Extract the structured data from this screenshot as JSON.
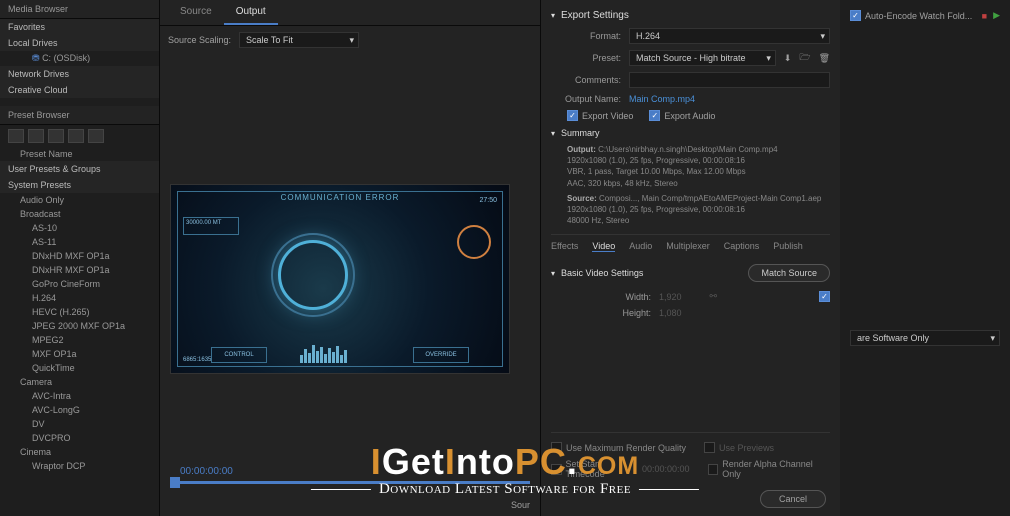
{
  "leftPanel": {
    "header1": "Media Browser",
    "favorites": "Favorites",
    "localDrives": "Local Drives",
    "cDrive": "C: (OSDisk)",
    "networkDrives": "Network Drives",
    "creativeCloud": "Creative Cloud",
    "header2": "Preset Browser",
    "presetName": "Preset Name",
    "userPresets": "User Presets & Groups",
    "systemPresets": "System Presets",
    "items": [
      "Audio Only",
      "Broadcast",
      "AS-10",
      "AS-11",
      "DNxHD MXF OP1a",
      "DNxHR MXF OP1a",
      "GoPro CineForm",
      "H.264",
      "HEVC (H.265)",
      "JPEG 2000 MXF OP1a",
      "MPEG2",
      "MXF OP1a",
      "QuickTime"
    ],
    "camera": "Camera",
    "camItems": [
      "AVC-Intra",
      "AVC-LongG",
      "DV",
      "DVCPRO"
    ],
    "cinema": "Cinema",
    "wraptor": "Wraptor DCP"
  },
  "center": {
    "tabSource": "Source",
    "tabOutput": "Output",
    "scalingLabel": "Source Scaling:",
    "scalingValue": "Scale To Fit",
    "hud": {
      "title": "COMMUNICATION ERROR",
      "boxL": "30000.00 MT",
      "boxR": "27:50",
      "btnL": "CONTROL",
      "btnR": "OVERRIDE",
      "bl": "6865:1635"
    },
    "timecode": "00:00:00:00",
    "sourceLabel": "Sour"
  },
  "export": {
    "header": "Export Settings",
    "formatLabel": "Format:",
    "formatValue": "H.264",
    "presetLabel": "Preset:",
    "presetValue": "Match Source - High bitrate",
    "commentsLabel": "Comments:",
    "outputNameLabel": "Output Name:",
    "outputNameValue": "Main Comp.mp4",
    "exportVideo": "Export Video",
    "exportAudio": "Export Audio",
    "summaryHeader": "Summary",
    "outputLabel": "Output:",
    "outputLines": [
      "C:\\Users\\nirbhay.n.singh\\Desktop\\Main Comp.mp4",
      "1920x1080 (1.0), 25 fps, Progressive, 00:00:08:16",
      "VBR, 1 pass, Target 10.00 Mbps, Max 12.00 Mbps",
      "AAC, 320 kbps, 48 kHz, Stereo"
    ],
    "sourceLabel": "Source:",
    "sourceLines": [
      "Composi..., Main Comp/tmpAEtoAMEProject-Main Comp1.aep",
      "1920x1080 (1.0), 25 fps, Progressive, 00:00:08:16",
      "48000 Hz, Stereo"
    ],
    "tabs": [
      "Effects",
      "Video",
      "Audio",
      "Multiplexer",
      "Captions",
      "Publish"
    ],
    "basicHeader": "Basic Video Settings",
    "matchBtn": "Match Source",
    "widthLabel": "Width:",
    "widthValue": "1,920",
    "heightLabel": "Height:",
    "heightValue": "1,080",
    "maxQuality": "Use Maximum Render Quality",
    "usePreviews": "Use Previews",
    "startTC": "Set Start Timecode",
    "startTCVal": "00:00:00:00",
    "alphaOnly": "Render Alpha Channel Only",
    "cancel": "Cancel"
  },
  "farRight": {
    "autoEncode": "Auto-Encode Watch Fold...",
    "softwareOnly": "are Software Only"
  },
  "watermark": {
    "brand": "IGetIntoPC.com",
    "tagline": "Download Latest Software for Free"
  }
}
